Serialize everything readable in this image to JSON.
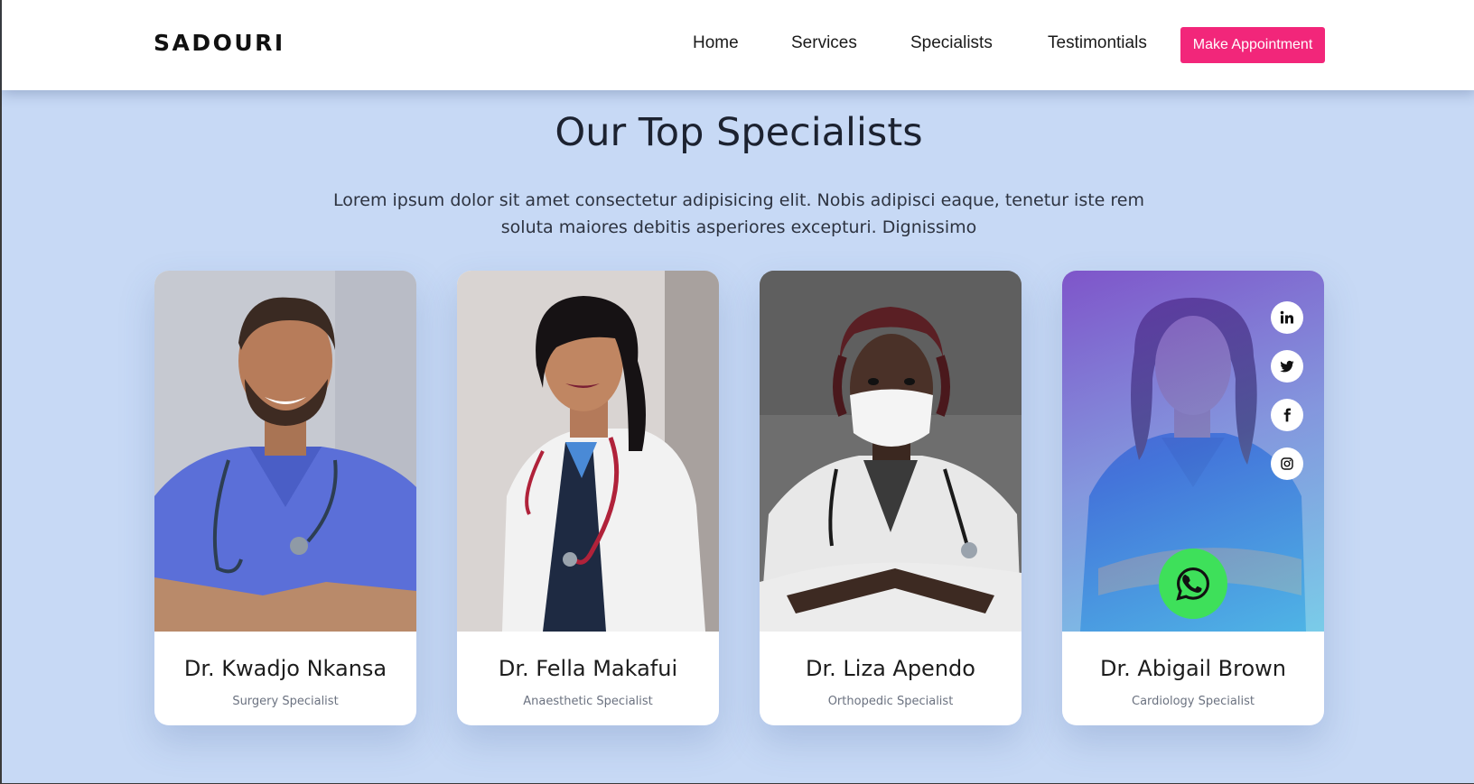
{
  "header": {
    "brand": "SADOURI",
    "nav": [
      {
        "label": "Home"
      },
      {
        "label": "Services"
      },
      {
        "label": "Specialists"
      },
      {
        "label": "Testimontials"
      }
    ],
    "cta_label": "Make Appointment",
    "cta_color": "#f2267a"
  },
  "section": {
    "title": "Our Top Specialists",
    "description": "Lorem ipsum dolor sit amet consectetur adipisicing elit. Nobis adipisci eaque, tenetur iste rem soluta maiores debitis asperiores excepturi. Dignissimo"
  },
  "specialists": [
    {
      "name": "Dr. Kwadjo Nkansa",
      "role": "Surgery Specialist"
    },
    {
      "name": "Dr. Fella Makafui",
      "role": "Anaesthetic Specialist"
    },
    {
      "name": "Dr. Liza Apendo",
      "role": "Orthopedic Specialist"
    },
    {
      "name": "Dr. Abigail Brown",
      "role": "Cardiology Specialist",
      "social_icons": [
        "linkedin-icon",
        "twitter-icon",
        "facebook-icon",
        "instagram-icon"
      ],
      "whatsapp_icon": "whatsapp-icon"
    }
  ],
  "colors": {
    "background": "#c7d9f5",
    "overlay_start": "#6834c4",
    "overlay_end": "#5ac8eb",
    "whatsapp": "#3ee05a"
  }
}
